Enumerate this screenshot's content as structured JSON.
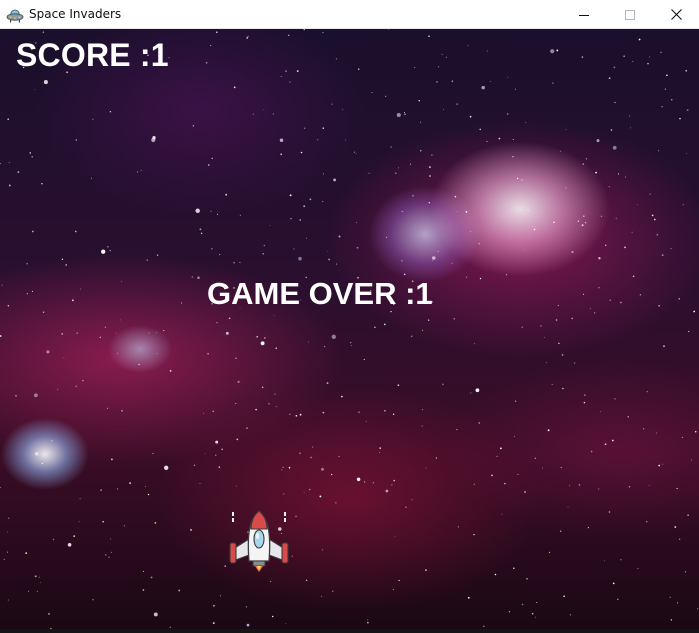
{
  "window": {
    "title": "Space Invaders",
    "icon": "ufo-icon",
    "controls": [
      "minimize-icon",
      "maximize-icon",
      "close-icon"
    ]
  },
  "game": {
    "score_text": "SCORE :1",
    "game_over_text": "GAME OVER :1",
    "player": "spaceship-icon",
    "background": "nebula-starfield"
  }
}
